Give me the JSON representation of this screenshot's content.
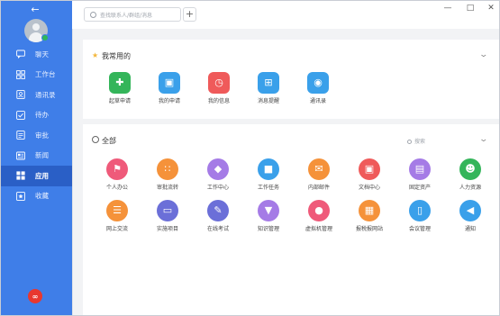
{
  "search": {
    "placeholder": "查找联系人/群组/消息"
  },
  "sidebar": {
    "items": [
      {
        "label": "聊天",
        "icon": "chat-icon"
      },
      {
        "label": "工作台",
        "icon": "grid-icon"
      },
      {
        "label": "通讯录",
        "icon": "contacts-icon"
      },
      {
        "label": "待办",
        "icon": "checkbox-icon"
      },
      {
        "label": "审批",
        "icon": "approval-icon"
      },
      {
        "label": "新闻",
        "icon": "news-icon"
      },
      {
        "label": "应用",
        "icon": "apps-icon",
        "active": true
      },
      {
        "label": "收藏",
        "icon": "favorites-icon"
      }
    ]
  },
  "favorites": {
    "title": "我常用的",
    "apps": [
      {
        "label": "起草申请",
        "color": "#34b55a",
        "icon": "bag-plus-icon"
      },
      {
        "label": "我的申请",
        "color": "#3aa0ea",
        "icon": "bag-icon"
      },
      {
        "label": "我的信息",
        "color": "#ef5a5a",
        "icon": "alarm-icon"
      },
      {
        "label": "消息提醒",
        "color": "#3aa0ea",
        "icon": "message-plus-icon"
      },
      {
        "label": "通讯录",
        "color": "#3aa0ea",
        "icon": "contact-book-icon"
      }
    ]
  },
  "all_apps": {
    "title": "全部",
    "search_placeholder": "搜索",
    "rows": [
      [
        {
          "label": "个人办公",
          "color": "#ef5a7a",
          "icon": "tag-icon"
        },
        {
          "label": "审批流转",
          "color": "#f5923a",
          "icon": "apps-grid-icon"
        },
        {
          "label": "工作中心",
          "color": "#a57be6",
          "icon": "diamond-icon"
        },
        {
          "label": "工作任务",
          "color": "#3aa0ea",
          "icon": "chat-bubble-icon"
        },
        {
          "label": "内部邮件",
          "color": "#f5923a",
          "icon": "mail-icon"
        },
        {
          "label": "文档中心",
          "color": "#ef5a5a",
          "icon": "truck-icon"
        },
        {
          "label": "固定资产",
          "color": "#a57be6",
          "icon": "document-icon"
        },
        {
          "label": "人力资源",
          "color": "#34b55a",
          "icon": "person-icon"
        }
      ],
      [
        {
          "label": "网上交流",
          "color": "#f5923a",
          "icon": "list-icon"
        },
        {
          "label": "实施项目",
          "color": "#6b6fd8",
          "icon": "window-icon"
        },
        {
          "label": "在线考试",
          "color": "#6b6fd8",
          "icon": "person-edit-icon"
        },
        {
          "label": "知识管理",
          "color": "#a57be6",
          "icon": "funnel-icon"
        },
        {
          "label": "虚拟机管理",
          "color": "#ef5a7a",
          "icon": "apple-icon"
        },
        {
          "label": "报税报网站",
          "color": "#f5923a",
          "icon": "calendar-icon"
        },
        {
          "label": "会议管理",
          "color": "#3aa0ea",
          "icon": "phone-icon"
        },
        {
          "label": "通知",
          "color": "#3aa0ea",
          "icon": "speaker-icon"
        }
      ]
    ]
  }
}
